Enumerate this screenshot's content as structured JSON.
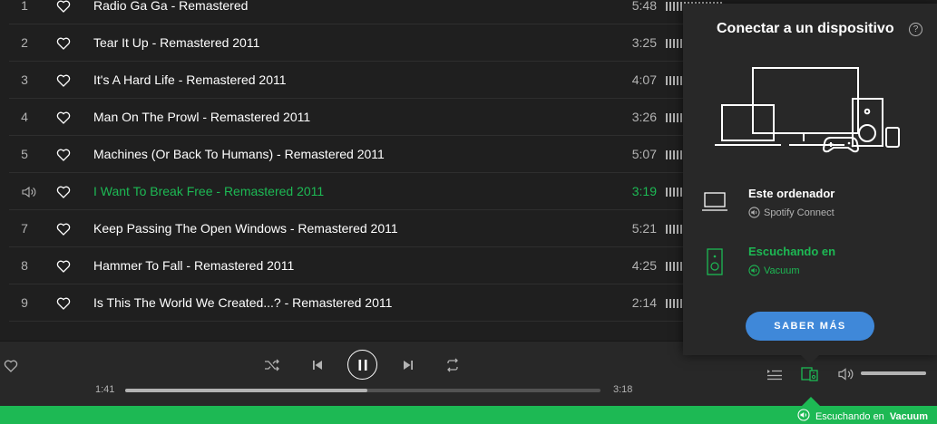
{
  "tracklist": [
    {
      "number": "1",
      "title": "Radio Ga Ga - Remastered",
      "duration": "5:48",
      "playing": false
    },
    {
      "number": "2",
      "title": "Tear It Up - Remastered 2011",
      "duration": "3:25",
      "playing": false
    },
    {
      "number": "3",
      "title": "It's A Hard Life - Remastered 2011",
      "duration": "4:07",
      "playing": false
    },
    {
      "number": "4",
      "title": "Man On The Prowl - Remastered 2011",
      "duration": "3:26",
      "playing": false
    },
    {
      "number": "5",
      "title": "Machines (Or Back To Humans) - Remastered 2011",
      "duration": "5:07",
      "playing": false
    },
    {
      "number": "",
      "title": "I Want To Break Free - Remastered 2011",
      "duration": "3:19",
      "playing": true
    },
    {
      "number": "7",
      "title": "Keep Passing The Open Windows - Remastered 2011",
      "duration": "5:21",
      "playing": false
    },
    {
      "number": "8",
      "title": "Hammer To Fall - Remastered 2011",
      "duration": "4:25",
      "playing": false
    },
    {
      "number": "9",
      "title": "Is This The World We Created...? - Remastered 2011",
      "duration": "2:14",
      "playing": false
    }
  ],
  "player": {
    "current_time": "1:41",
    "total_time": "3:18",
    "progress_fraction": 0.51,
    "volume_fraction": 1.0
  },
  "popup": {
    "title": "Conectar a un dispositivo",
    "help_symbol": "?",
    "devices": [
      {
        "name": "Este ordenador",
        "subtitle": "Spotify Connect",
        "icon": "laptop-icon",
        "active": false
      },
      {
        "name": "Escuchando en",
        "subtitle": "Vacuum",
        "icon": "speaker-device-icon",
        "active": true
      }
    ],
    "learn_more_label": "SABER MÁS"
  },
  "statusbar": {
    "prefix": "Escuchando en",
    "device": "Vacuum"
  },
  "colors": {
    "accent": "#1db954",
    "button": "#3f88d9",
    "background": "#1f1f1f",
    "panel": "#282828"
  }
}
